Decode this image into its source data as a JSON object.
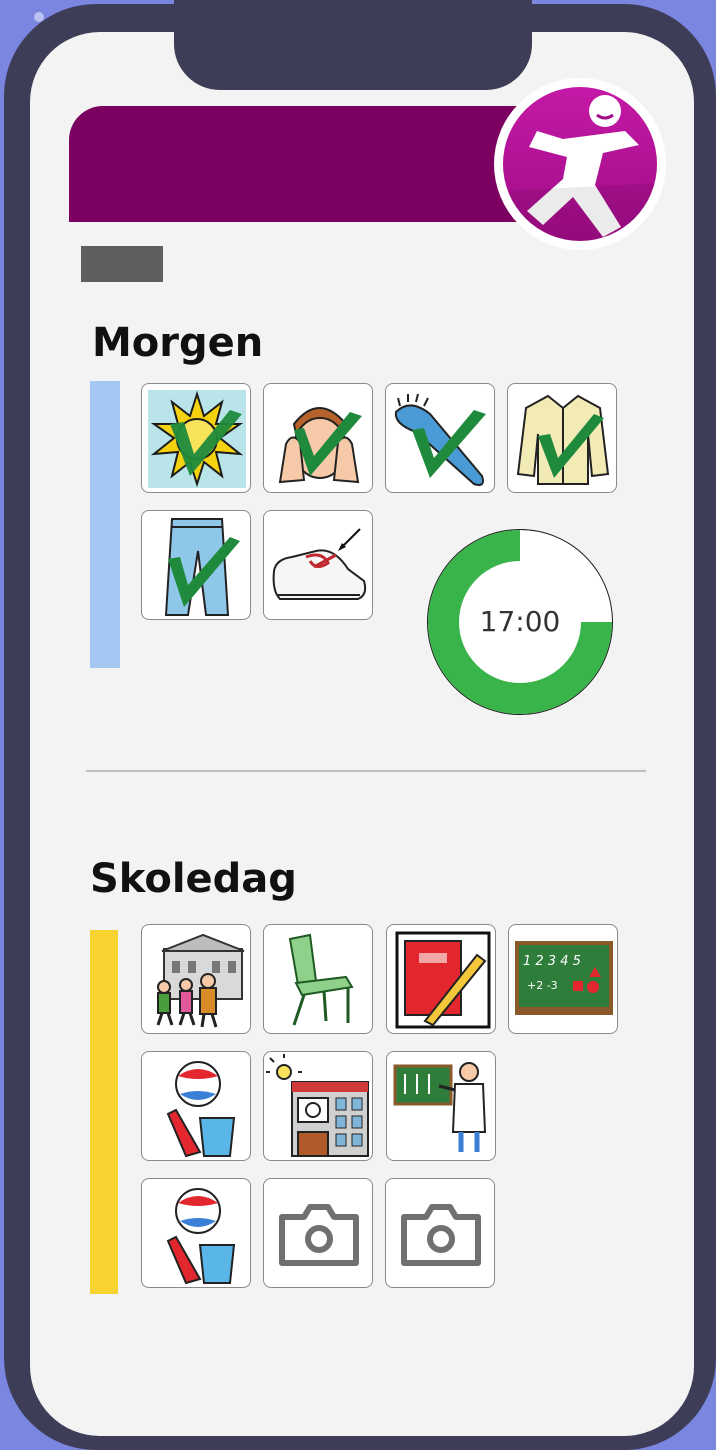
{
  "sections": {
    "morning": {
      "title": "Morgen",
      "bar_color": "#a4c8f2",
      "tasks": [
        {
          "icon": "sun-icon",
          "done": true
        },
        {
          "icon": "wash-face-icon",
          "done": true
        },
        {
          "icon": "hairbrush-icon",
          "done": true
        },
        {
          "icon": "cardigan-icon",
          "done": true
        },
        {
          "icon": "jeans-icon",
          "done": true
        },
        {
          "icon": "tie-shoes-icon",
          "done": false
        }
      ],
      "timer": {
        "label": "17:00",
        "remaining_fraction": 0.75,
        "color": "#39b44a"
      }
    },
    "school": {
      "title": "Skoledag",
      "bar_color": "#f8d22f",
      "tasks": [
        {
          "icon": "going-to-school-icon"
        },
        {
          "icon": "chair-icon"
        },
        {
          "icon": "notebook-pencil-icon"
        },
        {
          "icon": "math-blackboard-icon"
        },
        {
          "icon": "beach-toys-icon"
        },
        {
          "icon": "cafeteria-icon"
        },
        {
          "icon": "teacher-icon"
        },
        {
          "icon": "beach-toys-icon"
        },
        {
          "icon": "camera-icon"
        },
        {
          "icon": "camera-icon"
        }
      ]
    }
  },
  "colors": {
    "header": "#7c0060",
    "logo": "#b8129a",
    "check": "#1f8a3c"
  }
}
